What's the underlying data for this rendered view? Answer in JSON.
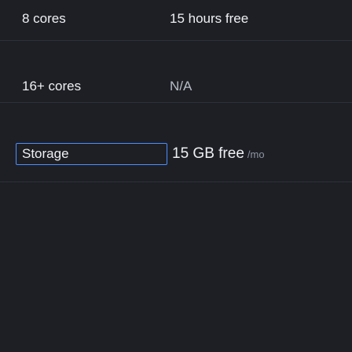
{
  "rows": [
    {
      "label": "8 cores",
      "value": "15 hours free"
    },
    {
      "label": "16+ cores",
      "value": "N/A"
    },
    {
      "label": "Storage",
      "value": "15 GB free",
      "suffix": "/mo"
    }
  ],
  "colors": {
    "background": "#1d1f25",
    "text": "#eef0f3",
    "muted": "#8f94a0",
    "focus_outline": "#4c8dff"
  }
}
